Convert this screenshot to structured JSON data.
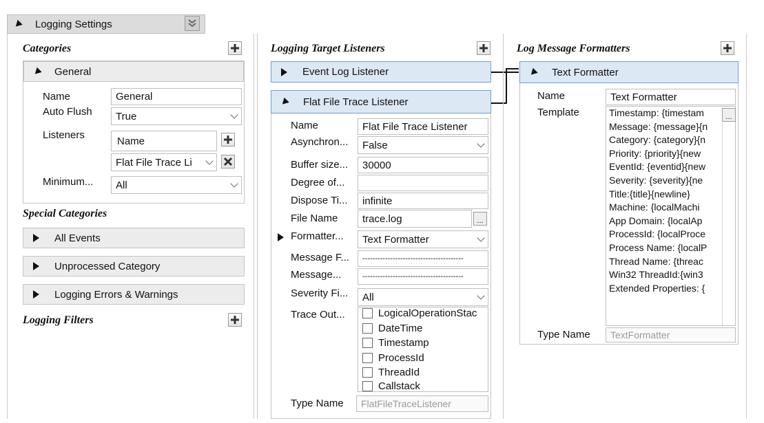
{
  "header": {
    "title": "Logging Settings"
  },
  "categories": {
    "title": "Categories",
    "general": {
      "label": "General",
      "name_label": "Name",
      "name_value": "General",
      "autoflush_label": "Auto Flush",
      "autoflush_value": "True",
      "listeners_label": "Listeners",
      "listeners_col": "Name",
      "listener_value": "Flat File Trace Li",
      "minimum_label": "Minimum...",
      "minimum_value": "All"
    }
  },
  "special": {
    "title": "Special Categories",
    "items": [
      "All Events",
      "Unprocessed Category",
      "Logging Errors & Warnings"
    ]
  },
  "filters": {
    "title": "Logging Filters"
  },
  "listeners": {
    "title": "Logging Target Listeners",
    "event_log": "Event Log Listener",
    "flat_file": {
      "label": "Flat File Trace Listener",
      "props": [
        {
          "label": "Name",
          "value": "Flat File Trace Listener"
        },
        {
          "label": "Asynchron...",
          "value": "False"
        },
        {
          "label": "Buffer size...",
          "value": "30000"
        },
        {
          "label": "Degree of...",
          "value": ""
        },
        {
          "label": "Dispose Ti...",
          "value": "infinite"
        },
        {
          "label": "File Name",
          "value": "trace.log"
        },
        {
          "label": "Formatter...",
          "value": "Text Formatter"
        },
        {
          "label": "Message F...",
          "value": "----------------------------------------"
        },
        {
          "label": "Message...",
          "value": "----------------------------------------"
        },
        {
          "label": "Severity Fi...",
          "value": "All"
        }
      ],
      "trace_label": "Trace Out...",
      "trace_options": [
        "LogicalOperationStac",
        "DateTime",
        "Timestamp",
        "ProcessId",
        "ThreadId",
        "Callstack"
      ],
      "type_label": "Type Name",
      "type_value": "FlatFileTraceListener"
    }
  },
  "formatters": {
    "title": "Log Message Formatters",
    "text": {
      "label": "Text Formatter",
      "name_label": "Name",
      "name_value": "Text Formatter",
      "template_label": "Template",
      "template_lines": [
        "Timestamp: {timestam",
        "Message: {message}{n",
        "Category: {category}{n",
        "Priority: {priority}{new",
        "EventId: {eventid}{new",
        "Severity: {severity}{ne",
        "Title:{title}{newline}",
        "Machine: {localMachi",
        "App Domain: {localAp",
        "ProcessId: {localProce",
        "Process Name: {localP",
        "Thread Name: {threac",
        "Win32 ThreadId:{win3",
        "Extended Properties: {"
      ],
      "type_label": "Type Name",
      "type_value": "TextFormatter"
    }
  },
  "ellipsis": "..."
}
